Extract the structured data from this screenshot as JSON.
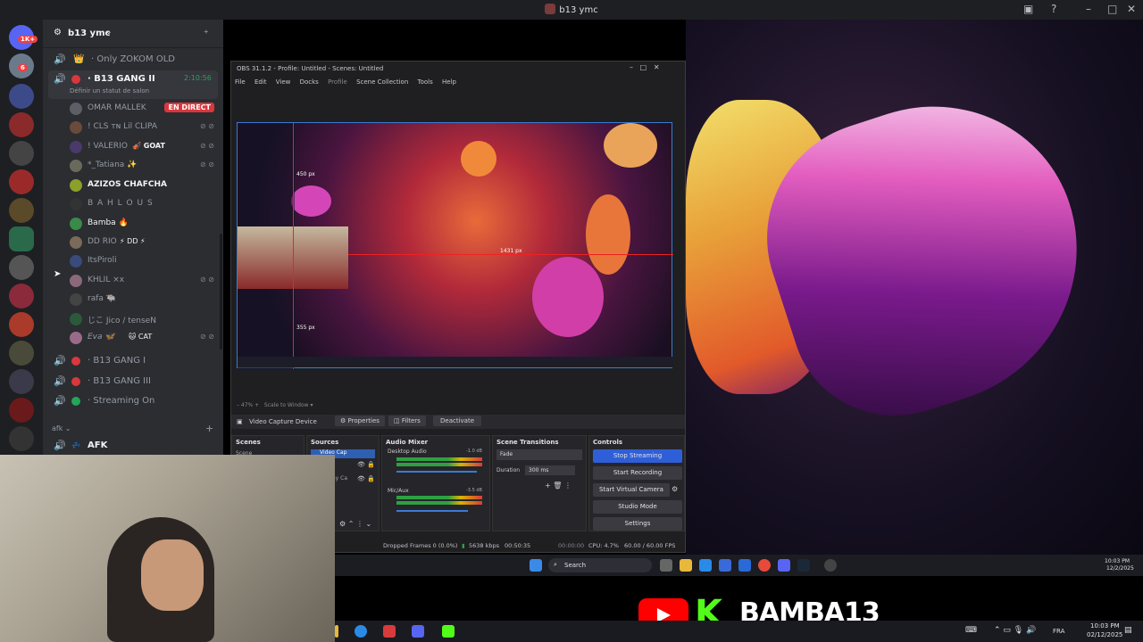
{
  "window": {
    "title": "b13 ymc"
  },
  "server": {
    "name": "b13 ymc",
    "badge_1k": "1K+",
    "badge_6": "6"
  },
  "channels": [
    {
      "name": "Only ZOKOM OLD",
      "emoji": "👑"
    },
    {
      "name": "B13 GANG II",
      "status": "Définir un statut de salon",
      "timer": "2:10:56"
    },
    {
      "name": "B13 GANG I"
    },
    {
      "name": "B13 GANG III"
    },
    {
      "name": "Streaming On"
    }
  ],
  "users": [
    {
      "name": "OMAR MALLEK",
      "badge": "EN DIRECT"
    },
    {
      "name": "! CLS ᴛɴ Lil CLIPA"
    },
    {
      "name": "! VALERIO",
      "tag": "🎻 GOAT"
    },
    {
      "name": "*_Tatiana ✨"
    },
    {
      "name": "AZIZOS CHAFCHA"
    },
    {
      "name": "B A H L O U S"
    },
    {
      "name": "Bamba 🔥"
    },
    {
      "name": "DD RIO",
      "tag": "⚡ DD ⚡"
    },
    {
      "name": "ItsPiroli"
    },
    {
      "name": "KHLIL ×x"
    },
    {
      "name": "rafa 🐃"
    },
    {
      "name": "じこ Jico / tenseN"
    },
    {
      "name": "Eva 🦋",
      "tag": "🐱 CAT"
    }
  ],
  "category": {
    "name": "afk",
    "channel": "AFK",
    "channel_prefix": "💤"
  },
  "obs": {
    "title": "OBS 31.1.2 - Profile: Untitled - Scenes: Untitled",
    "menu": [
      "File",
      "Edit",
      "View",
      "Docks",
      "Profile",
      "Scene Collection",
      "Tools",
      "Help"
    ],
    "zoom": "47%",
    "scale_label": "Scale to Window",
    "measure_top": "450 px",
    "measure_right": "1431 px",
    "measure_bottom": "355 px",
    "source_bar": {
      "source": "Video Capture Device",
      "properties": "Properties",
      "filters": "Filters",
      "deactivate": "Deactivate"
    },
    "docks": {
      "scenes": "Scenes",
      "sources": "Sources",
      "audio_mixer": "Audio Mixer",
      "transitions": "Scene Transitions",
      "controls": "Controls"
    },
    "scene_item": "Scene",
    "source_item": "Video Cap",
    "source_item2": "ay Ca",
    "mixer": [
      {
        "name": "Desktop Audio",
        "db": "-1.0 dB"
      },
      {
        "name": "Mic/Aux",
        "db": "-3.5 dB"
      }
    ],
    "transition": {
      "type": "Fade",
      "duration_label": "Duration",
      "duration": "300 ms"
    },
    "controls": [
      "Stop Streaming",
      "Start Recording",
      "Start Virtual Camera",
      "Studio Mode",
      "Settings"
    ],
    "status": {
      "dropped": "Dropped Frames 0 (0.0%)",
      "bitrate": "5638 kbps",
      "stream_time": "00:50:35",
      "rec_time": "00:00:00",
      "cpu": "CPU: 4.7%",
      "fps": "60.00 / 60.00 FPS"
    }
  },
  "inner_taskbar": {
    "search": "Search",
    "time": "10:03 PM",
    "date": "12/2/2025"
  },
  "outer_taskbar": {
    "lang": "FRA",
    "time": "10:03 PM",
    "date": "02/12/2025"
  },
  "overlay": {
    "k": "K",
    "channel": "BAMBA13"
  },
  "colors": {
    "discord_bg": "#2b2d31",
    "accent_blue": "#3a7bd5",
    "kick_green": "#53fc18",
    "youtube_red": "#ff0000",
    "live_red": "#da373c",
    "online_green": "#23a55a"
  }
}
